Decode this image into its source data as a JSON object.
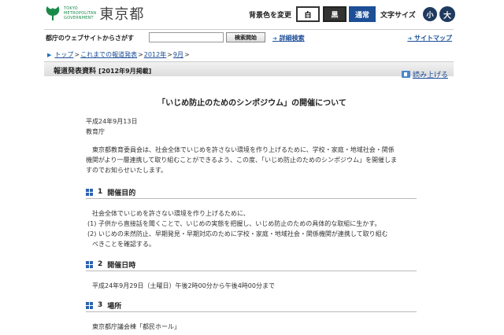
{
  "header": {
    "logo_sub": [
      "TOKYO",
      "METROPOLITAN",
      "GOVERNMENT"
    ],
    "logo_title": "東京都",
    "bg_label": "背景色を変更",
    "bg_white": "白",
    "bg_black": "黒",
    "bg_normal": "通常",
    "fs_label": "文字サイズ",
    "fs_small": "小",
    "fs_large": "大"
  },
  "search": {
    "caption": "都庁のウェブサイトからさがす",
    "input_value": "",
    "button": "検索開始",
    "advanced": "詳細検索",
    "sitemap": "サイトマップ"
  },
  "breadcrumb": {
    "items": [
      "トップ",
      "これまでの報道発表",
      "2012年",
      "9月"
    ],
    "separator": ">"
  },
  "report": {
    "title": "報道発表資料",
    "period": "[2012年9月掲載]",
    "read_aloud": "読み上げる"
  },
  "content": {
    "main_title": "「いじめ防止のためのシンポジウム」の開催について",
    "date": "平成24年9月13日",
    "dept": "教育庁",
    "intro_lines": [
      "東京都教育委員会は、社会全体でいじめを許さない環境を作り上げるために、学校・家庭・地域社会・関係",
      "機関がより一層連携して取り組むことができるよう、この度、「いじめ防止のためのシンポジウム」を開催しま",
      "すのでお知らせいたします。"
    ],
    "sections": [
      {
        "num": "1",
        "title": "開催目的",
        "lines": [
          "社会全体でいじめを許さない環境を作り上げるために、",
          "(1) 子供から直接話を聞くことで、いじめの実態を把握し、いじめ防止のための具体的な取組に生かす。",
          "(2) いじめの未然防止、早期発見・早期対応のために学校・家庭・地域社会・関係機関が連携して取り組む",
          "べきことを確認する。"
        ]
      },
      {
        "num": "2",
        "title": "開催日時",
        "lines": [
          "平成24年9月29日（土曜日）午後2時00分から午後4時00分まで"
        ]
      },
      {
        "num": "3",
        "title": "場所",
        "lines": [
          "東京都庁議会棟「都民ホール」"
        ]
      }
    ]
  },
  "colors": {
    "accent_blue": "#1d4e96",
    "logo_green": "#1a8a4a"
  }
}
